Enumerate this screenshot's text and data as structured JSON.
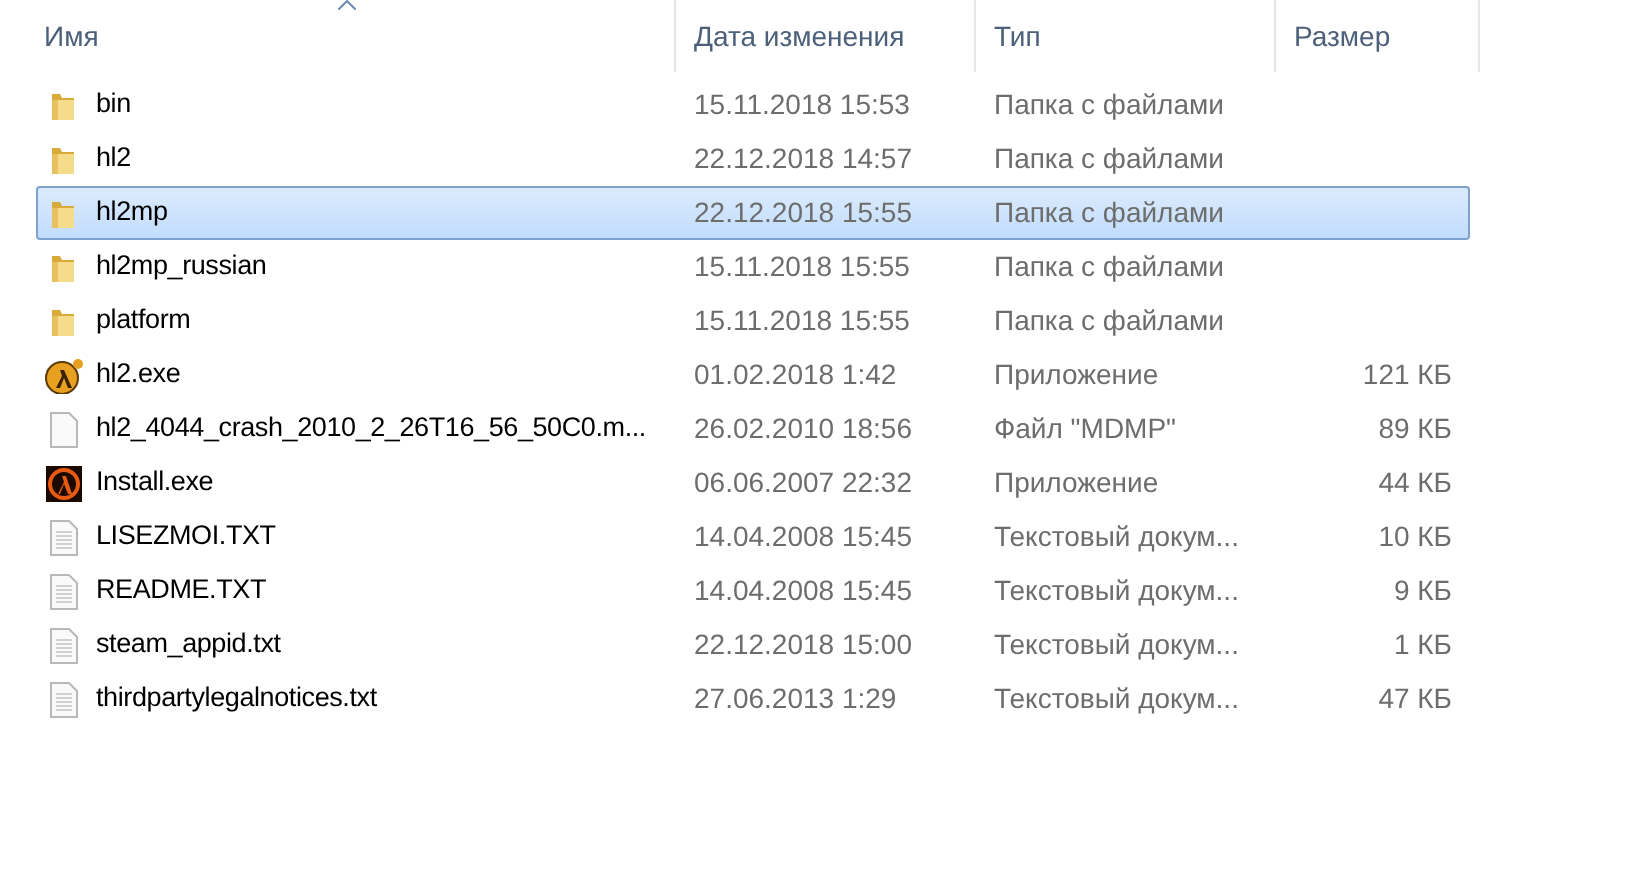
{
  "columns": [
    {
      "label": "Имя",
      "sorted": true
    },
    {
      "label": "Дата изменения",
      "sorted": false
    },
    {
      "label": "Тип",
      "sorted": false
    },
    {
      "label": "Размер",
      "sorted": false
    }
  ],
  "rows": [
    {
      "kind": "folder",
      "name": "bin",
      "date": "15.11.2018 15:53",
      "type": "Папка с файлами",
      "size": "",
      "selected": false
    },
    {
      "kind": "folder",
      "name": "hl2",
      "date": "22.12.2018 14:57",
      "type": "Папка с файлами",
      "size": "",
      "selected": false
    },
    {
      "kind": "folder",
      "name": "hl2mp",
      "date": "22.12.2018 15:55",
      "type": "Папка с файлами",
      "size": "",
      "selected": true
    },
    {
      "kind": "folder",
      "name": "hl2mp_russian",
      "date": "15.11.2018 15:55",
      "type": "Папка с файлами",
      "size": "",
      "selected": false
    },
    {
      "kind": "folder",
      "name": "platform",
      "date": "15.11.2018 15:55",
      "type": "Папка с файлами",
      "size": "",
      "selected": false
    },
    {
      "kind": "game",
      "name": "hl2.exe",
      "date": "01.02.2018 1:42",
      "type": "Приложение",
      "size": "121 КБ",
      "selected": false
    },
    {
      "kind": "file",
      "name": "hl2_4044_crash_2010_2_26T16_56_50C0.m...",
      "date": "26.02.2010 18:56",
      "type": "Файл \"MDMP\"",
      "size": "89 КБ",
      "selected": false
    },
    {
      "kind": "installer",
      "name": "Install.exe",
      "date": "06.06.2007 22:32",
      "type": "Приложение",
      "size": "44 КБ",
      "selected": false
    },
    {
      "kind": "text",
      "name": "LISEZMOI.TXT",
      "date": "14.04.2008 15:45",
      "type": "Текстовый докум...",
      "size": "10 КБ",
      "selected": false
    },
    {
      "kind": "text",
      "name": "README.TXT",
      "date": "14.04.2008 15:45",
      "type": "Текстовый докум...",
      "size": "9 КБ",
      "selected": false
    },
    {
      "kind": "text",
      "name": "steam_appid.txt",
      "date": "22.12.2018 15:00",
      "type": "Текстовый докум...",
      "size": "1 КБ",
      "selected": false
    },
    {
      "kind": "text",
      "name": "thirdpartylegalnotices.txt",
      "date": "27.06.2013 1:29",
      "type": "Текстовый докум...",
      "size": "47 КБ",
      "selected": false
    }
  ]
}
